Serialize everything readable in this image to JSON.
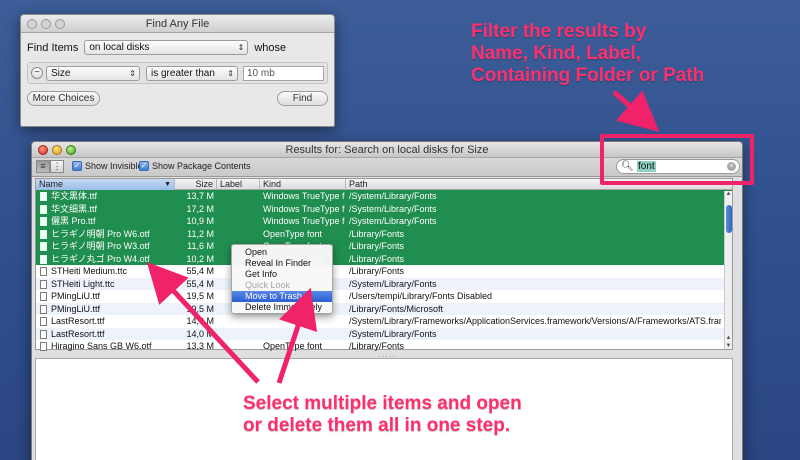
{
  "find_window": {
    "title": "Find Any File",
    "find_items_label": "Find Items",
    "location_value": "on local disks",
    "whose_label": "whose",
    "criteria": {
      "attribute": "Size",
      "operator": "is greater than",
      "value_placeholder": "10 mb"
    },
    "more_choices_label": "More Choices",
    "find_button_label": "Find"
  },
  "results_window": {
    "title": "Results for: Search on local disks for Size",
    "toolbar": {
      "show_invisibles_label": "Show Invisibles",
      "show_package_contents_label": "Show Package Contents",
      "search_value": "font"
    },
    "columns": {
      "name": "Name",
      "size": "Size",
      "label": "Label",
      "kind": "Kind",
      "path": "Path"
    },
    "rows": [
      {
        "name": "华文黑体.ttf",
        "size": "13,7 M",
        "label": "",
        "kind": "Windows TrueType font",
        "path": "/System/Library/Fonts",
        "selected": true
      },
      {
        "name": "华文细黑.ttf",
        "size": "17,2 M",
        "label": "",
        "kind": "Windows TrueType font",
        "path": "/System/Library/Fonts",
        "selected": true
      },
      {
        "name": "儷黑 Pro.ttf",
        "size": "10,9 M",
        "label": "",
        "kind": "Windows TrueType font",
        "path": "/System/Library/Fonts",
        "selected": true
      },
      {
        "name": "ヒラギノ明朝 Pro W6.otf",
        "size": "11,2 M",
        "label": "",
        "kind": "OpenType font",
        "path": "/Library/Fonts",
        "selected": true
      },
      {
        "name": "ヒラギノ明朝 Pro W3.otf",
        "size": "11,6 M",
        "label": "",
        "kind": "OpenType font",
        "path": "/Library/Fonts",
        "selected": true
      },
      {
        "name": "ヒラギノ丸ゴ Pro W4.otf",
        "size": "10,2 M",
        "label": "",
        "kind": "OpenType font",
        "path": "/Library/Fonts",
        "selected": true
      },
      {
        "name": "STHeiti Medium.ttc",
        "size": "55,4 M",
        "label": "",
        "kind": "",
        "path": "/Library/Fonts",
        "selected": false
      },
      {
        "name": "STHeiti Light.ttc",
        "size": "55,4 M",
        "label": "",
        "kind": "",
        "path": "/System/Library/Fonts",
        "selected": false
      },
      {
        "name": "PMingLiU.ttf",
        "size": "19,5 M",
        "label": "",
        "kind": "",
        "path": "/Users/tempi/Library/Fonts Disabled",
        "selected": false
      },
      {
        "name": "PMingLiU.ttf",
        "size": "19,5 M",
        "label": "",
        "kind": "",
        "path": "/Library/Fonts/Microsoft",
        "selected": false
      },
      {
        "name": "LastResort.ttf",
        "size": "14,0 M",
        "label": "",
        "kind": "",
        "path": "/System/Library/Frameworks/ApplicationServices.framework/Versions/A/Frameworks/ATS.framework/Versions/A/Resou...",
        "selected": false
      },
      {
        "name": "LastResort.ttf",
        "size": "14,0 M",
        "label": "",
        "kind": "",
        "path": "/System/Library/Fonts",
        "selected": false
      },
      {
        "name": "Hiragino Sans GB W6.otf",
        "size": "13,3 M",
        "label": "",
        "kind": "OpenType font",
        "path": "/Library/Fonts",
        "selected": false
      }
    ],
    "context_menu": [
      {
        "label": "Open",
        "disabled": false,
        "highlighted": false
      },
      {
        "label": "Reveal In Finder",
        "disabled": false,
        "highlighted": false
      },
      {
        "label": "Get Info",
        "disabled": false,
        "highlighted": false
      },
      {
        "label": "Quick Look",
        "disabled": true,
        "highlighted": false
      },
      {
        "label": "Move to Trash",
        "disabled": false,
        "highlighted": true
      },
      {
        "label": "Delete Immediately",
        "disabled": false,
        "highlighted": false
      }
    ]
  },
  "annotations": {
    "filter_text_lines": [
      "Filter the results by",
      "Name, Kind, Label,",
      "Containing Folder or Path"
    ],
    "select_text_lines": [
      "Select multiple items and open",
      "or delete them all in one step."
    ],
    "accent_color": "#ff2f6e",
    "selection_color": "#1f8e4e"
  }
}
